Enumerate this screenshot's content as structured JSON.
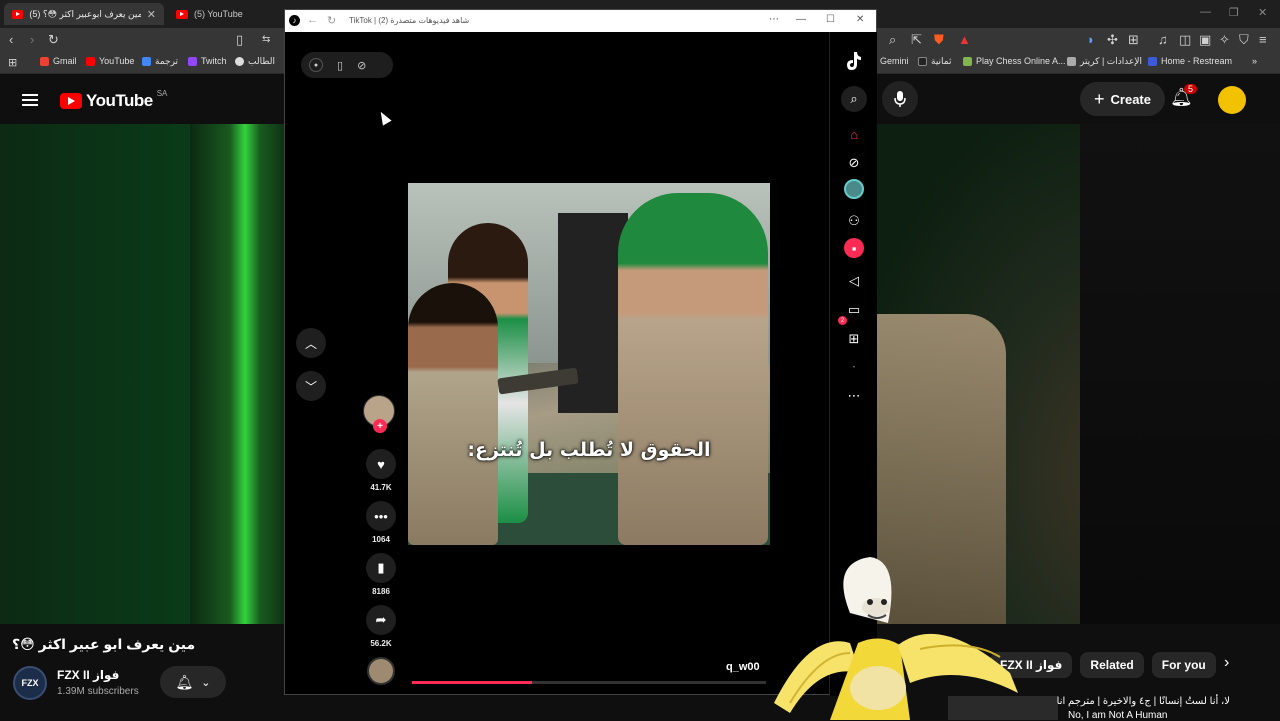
{
  "browser": {
    "tabs": [
      {
        "label": "(5) مين يعرف ابوعبير اكثر 😳؟ - ...",
        "active": true
      },
      {
        "label": "(5) YouTube",
        "active": false
      }
    ],
    "bookmarks": [
      {
        "label": "Gmail",
        "color": "#ea4335"
      },
      {
        "label": "YouTube",
        "color": "#ff0000"
      },
      {
        "label": "ترجمة",
        "color": "#4285f4"
      },
      {
        "label": "Twitch",
        "color": "#9146ff"
      },
      {
        "label": "الطالب",
        "color": "#dddddd"
      },
      {
        "label": "Gemini",
        "color": "#8ab4f8"
      },
      {
        "label": "ثمانية",
        "color": "#222222"
      },
      {
        "label": "Play Chess Online A...",
        "color": "#81b64c"
      },
      {
        "label": "الإعدادات | كريتر",
        "color": "#aaaaaa"
      },
      {
        "label": "Home - Restream",
        "color": "#3b5bdb"
      }
    ]
  },
  "youtube": {
    "logo_text": "YouTube",
    "country": "SA",
    "create_label": "Create",
    "notifications": "5",
    "video_title": "مين يعرف ابو عبير اكثر 😳؟",
    "channel": {
      "name": "FZX II فواز",
      "subscribers": "1.39M subscribers",
      "avatar_text": "FZX"
    },
    "chips": [
      "FZX II فواز",
      "Related",
      "For you"
    ],
    "rec_line1": "لا، أنا لستُ إنسانًا | ج٤ والاخيرة | مترجم انا",
    "rec_line2": "No, I am Not A Human"
  },
  "tiktok": {
    "window_title": "TikTok | شاهد فيديوهات متصدرة (2)",
    "caption": "الحقوق لا تُطلب بل تُنتزع:",
    "username": "q_w00",
    "progress": 0.34,
    "counts": {
      "likes": "41.7K",
      "comments": "1064",
      "saves": "8186",
      "shares": "56.2K"
    },
    "message_badge": "2"
  }
}
